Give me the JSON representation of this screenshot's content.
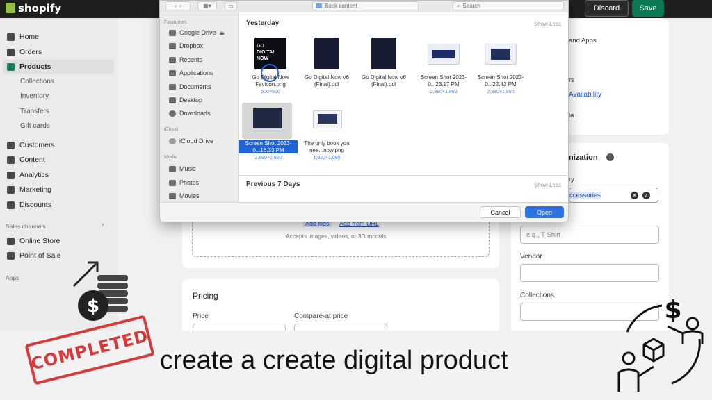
{
  "topbar": {
    "logo": "shopify",
    "discard_label": "Discard",
    "save_label": "Save"
  },
  "sidebar": {
    "items": [
      {
        "label": "Home"
      },
      {
        "label": "Orders"
      },
      {
        "label": "Products"
      },
      {
        "label": "Collections"
      },
      {
        "label": "Inventory"
      },
      {
        "label": "Transfers"
      },
      {
        "label": "Gift cards"
      },
      {
        "label": "Customers"
      },
      {
        "label": "Content"
      },
      {
        "label": "Analytics"
      },
      {
        "label": "Marketing"
      },
      {
        "label": "Discounts"
      }
    ],
    "sales_channels_label": "Sales channels",
    "channels": [
      {
        "label": "Online Store"
      },
      {
        "label": "Point of Sale"
      }
    ],
    "apps_label": "Apps"
  },
  "main": {
    "media": {
      "add_files": "Add files",
      "add_from_url": "Add from URL",
      "accepts": "Accepts images, videos, or 3D models"
    },
    "pricing": {
      "title": "Pricing",
      "price_label": "Price",
      "compare_label": "Compare-at price"
    },
    "right": {
      "apps_text": "and Apps",
      "availability_prefix": "rs",
      "availability_link": "Availability",
      "la_text": "la",
      "organization_title": "nization",
      "category_label": "ry",
      "category_value": "ccessories",
      "type_placeholder": "e.g., T-Shirt",
      "vendor_label": "Vendor",
      "collections_label": "Collections"
    }
  },
  "dialog": {
    "location": "Book content",
    "search_placeholder": "Search",
    "sidebar": {
      "favourites_label": "Favourites",
      "favourites": [
        {
          "label": "Google Drive"
        },
        {
          "label": "Dropbox"
        },
        {
          "label": "Recents"
        },
        {
          "label": "Applications"
        },
        {
          "label": "Documents"
        },
        {
          "label": "Desktop"
        },
        {
          "label": "Downloads"
        }
      ],
      "icloud_label": "iCloud",
      "icloud": [
        {
          "label": "iCloud Drive"
        }
      ],
      "media_label": "Media",
      "media": [
        {
          "label": "Music"
        },
        {
          "label": "Photos"
        },
        {
          "label": "Movies"
        }
      ]
    },
    "groups": {
      "yesterday": "Yesterday",
      "previous": "Previous 7 Days",
      "show_less": "Show Less"
    },
    "thumb_logo_text": "GO DIGITAL NOW",
    "files": [
      {
        "name": "Go Digital Now Favicon.png",
        "size": "500×500"
      },
      {
        "name": "Go Digital Now v6 (Final).pdf",
        "size": ""
      },
      {
        "name": "Go Digital Now v6 (Final).pdf",
        "size": ""
      },
      {
        "name": "Screen Shot 2023-0...23.17 PM",
        "size": "2,880×1,800"
      },
      {
        "name": "Screen Shot 2023-0...22.42 PM",
        "size": "2,880×1,800"
      },
      {
        "name": "Screen Shot 2023-0...16.33 PM",
        "size": "2,880×1,800"
      },
      {
        "name": "The only book you nee...now.png",
        "size": "1,920×1,080"
      }
    ],
    "cancel_label": "Cancel",
    "open_label": "Open"
  },
  "banner": {
    "stamp_text": "COMPLETED",
    "caption": "create a create digital product"
  },
  "colors": {
    "accent_green": "#0b7a53",
    "selection_blue": "#1e64d6",
    "stamp_red": "#d43c3c"
  }
}
